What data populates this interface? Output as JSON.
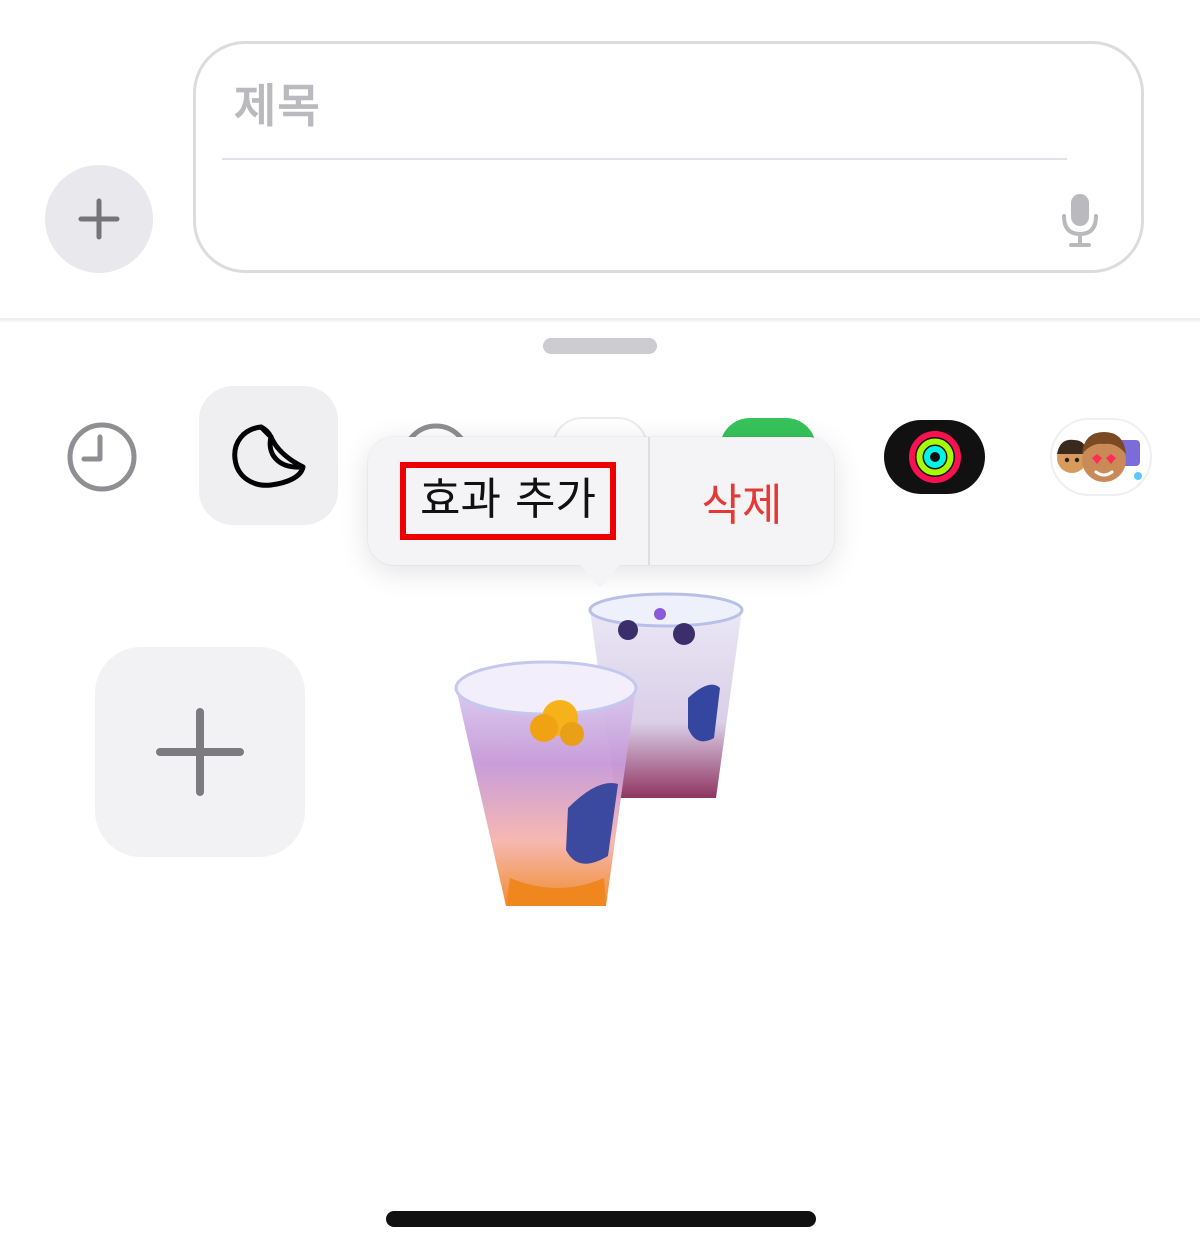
{
  "compose": {
    "subject_placeholder": "제목"
  },
  "context_menu": {
    "add_effect_label": "효과 추가",
    "delete_label": "삭제",
    "highlighted_item": "add_effect",
    "highlight_color": "#ee0000",
    "delete_color": "#e53935"
  },
  "app_strip": {
    "items": [
      {
        "name": "recent",
        "icon": "clock-icon"
      },
      {
        "name": "stickers",
        "icon": "sticker-peel-icon",
        "selected": true
      },
      {
        "name": "app-3",
        "icon": "circle-icon"
      },
      {
        "name": "app-4",
        "icon": "pill-icon"
      },
      {
        "name": "app-5",
        "icon": "green-app-icon",
        "color": "#36c35a"
      },
      {
        "name": "fitness",
        "icon": "activity-rings-icon"
      },
      {
        "name": "memoji",
        "icon": "memoji-icon"
      }
    ]
  },
  "stickers": {
    "items": [
      {
        "name": "add-sticker",
        "icon": "plus-icon"
      },
      {
        "name": "drinks-sticker",
        "icon": "drink-cups-icon"
      }
    ]
  },
  "colors": {
    "accent_green": "#36c35a",
    "destructive_red": "#e53935"
  }
}
